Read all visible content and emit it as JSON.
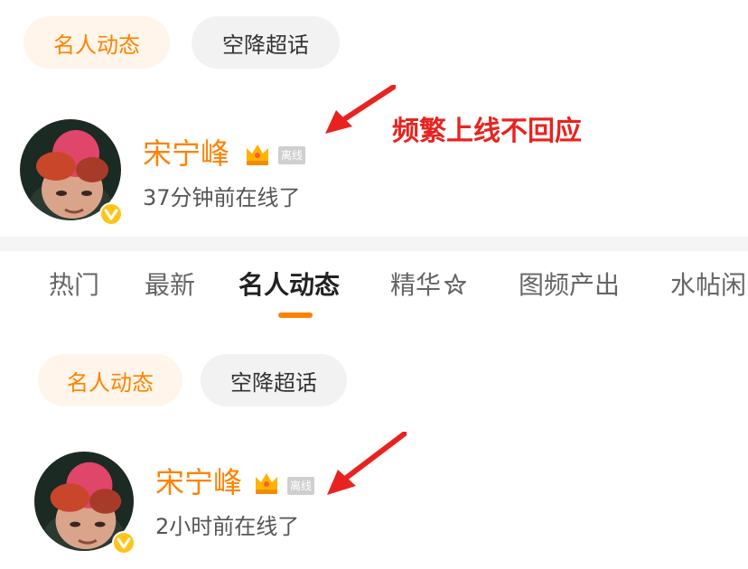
{
  "top_section": {
    "filter_pills": [
      {
        "label": "名人动态",
        "active": true
      },
      {
        "label": "空降超话",
        "active": false
      }
    ],
    "user": {
      "name": "宋宁峰",
      "offline_tag": "离线",
      "status": "37分钟前在线了"
    },
    "annotation": "频繁上线不回应"
  },
  "bottom_section": {
    "tabs": [
      {
        "label": "热门",
        "active": false
      },
      {
        "label": "最新",
        "active": false
      },
      {
        "label": "名人动态",
        "active": true
      },
      {
        "label": "精华",
        "active": false,
        "icon": "sparkle-icon"
      },
      {
        "label": "图频产出",
        "active": false
      },
      {
        "label": "水帖闲",
        "active": false
      }
    ],
    "filter_pills": [
      {
        "label": "名人动态",
        "active": true
      },
      {
        "label": "空降超话",
        "active": false
      }
    ],
    "user": {
      "name": "宋宁峰",
      "offline_tag": "离线",
      "status": "2小时前在线了"
    }
  },
  "colors": {
    "accent": "#ff8200",
    "pill_active_bg": "#fff5ea",
    "pill_inactive_bg": "#f2f2f2",
    "annotation_red": "#e8231f",
    "verified_badge": "#ffc41a"
  }
}
